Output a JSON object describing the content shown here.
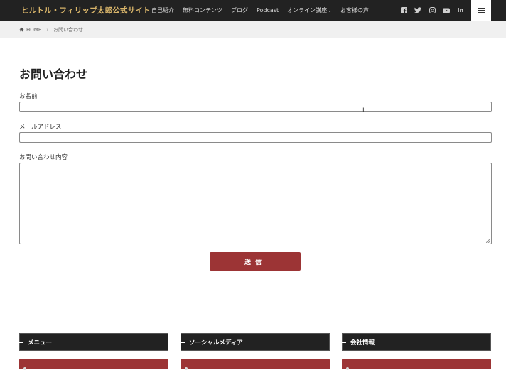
{
  "header": {
    "site_title": "ヒルトル・フィリップ太郎公式サイト",
    "nav": [
      {
        "label": "自己紹介"
      },
      {
        "label": "無料コンテンツ"
      },
      {
        "label": "ブログ"
      },
      {
        "label": "Podcast"
      },
      {
        "label": "オンライン講座",
        "has_dropdown": true
      },
      {
        "label": "お客様の声"
      }
    ],
    "social": [
      "facebook-icon",
      "twitter-icon",
      "instagram-icon",
      "youtube-icon",
      "linkedin-icon"
    ],
    "linkedin_text": "in"
  },
  "breadcrumb": {
    "home_label": "HOME",
    "separator": "›",
    "current": "お問い合わせ"
  },
  "form": {
    "title": "お問い合わせ",
    "name_label": "お名前",
    "name_value": "",
    "email_label": "メールアドレス",
    "email_value": "",
    "message_label": "お問い合わせ内容",
    "message_value": "",
    "submit_label": "送信"
  },
  "footer": {
    "widgets": [
      {
        "title": "メニュー"
      },
      {
        "title": "ソーシャルメディア"
      },
      {
        "title": "会社情報"
      }
    ]
  },
  "colors": {
    "header_bg": "#222222",
    "logo_gold": "#d9b56a",
    "accent_red": "#9c3435",
    "breadcrumb_bg": "#f0f0f0"
  }
}
